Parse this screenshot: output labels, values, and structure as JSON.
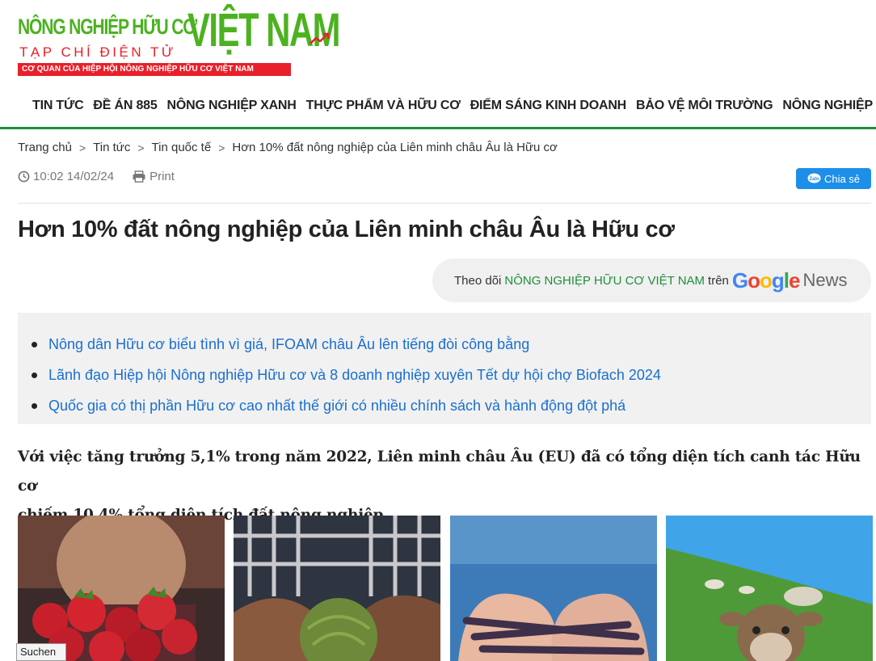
{
  "logo": {
    "line1": "NÔNG NGHIỆP HỮU CƠ",
    "line1_big": "VIỆT NAM",
    "subtitle": "TẠP CHÍ ĐIỆN TỬ",
    "strip": "CƠ QUAN CỦA HIỆP HỘI NÔNG NGHIỆP HỮU CƠ VIỆT NAM",
    "trend_icon": "trending-up-icon"
  },
  "nav": {
    "home_icon": "home-icon",
    "items": [
      "TIN TỨC",
      "ĐỀ ÁN 885",
      "NÔNG NGHIỆP XANH",
      "THỰC PHẨM VÀ HỮU CƠ",
      "ĐIỂM SÁNG KINH DOANH",
      "BẢO VỆ MÔI TRƯỜNG",
      "NÔNG NGHIỆP"
    ]
  },
  "breadcrumb": [
    "Trang chủ",
    "Tin tức",
    "Tin quốc tế",
    "Hơn 10% đất nông nghiệp của Liên minh châu Âu là Hữu cơ"
  ],
  "meta": {
    "datetime": "10:02 14/02/24",
    "print_label": "Print"
  },
  "share": {
    "label": "Chia sẻ"
  },
  "article": {
    "title": "Hơn 10% đất nông nghiệp của Liên minh châu Âu là Hữu cơ",
    "lead_line1": "Với việc tăng trưởng 5,1% trong năm 2022, Liên minh châu Âu (EU) đã có tổng diện tích canh tác Hữu cơ",
    "lead_line2": "chiếm 10,4% tổng diện tích đất nông nghiệp."
  },
  "gnews": {
    "prefix": "Theo dõi",
    "brand": "NÔNG NGHIỆP HỮU CƠ VIỆT NAM",
    "on": "trên",
    "news": "News"
  },
  "related": [
    "Nông dân Hữu cơ biểu tình vì giá, IFOAM châu Âu lên tiếng đòi công bằng",
    "Lãnh đạo Hiệp hội Nông nghiệp Hữu cơ và 8 doanh nghiệp xuyên Tết dự hội chợ Biofach 2024",
    "Quốc gia có thị phần Hữu cơ cao nhất thế giới có nhiều chính sách và hành động đột phá"
  ],
  "suchen": "Suchen",
  "colors": {
    "brand_green": "#4cb220",
    "brand_red": "#e8202a",
    "nav_border": "#1f8f3a",
    "link": "#1a6fd1",
    "share": "#1e8fe8"
  }
}
